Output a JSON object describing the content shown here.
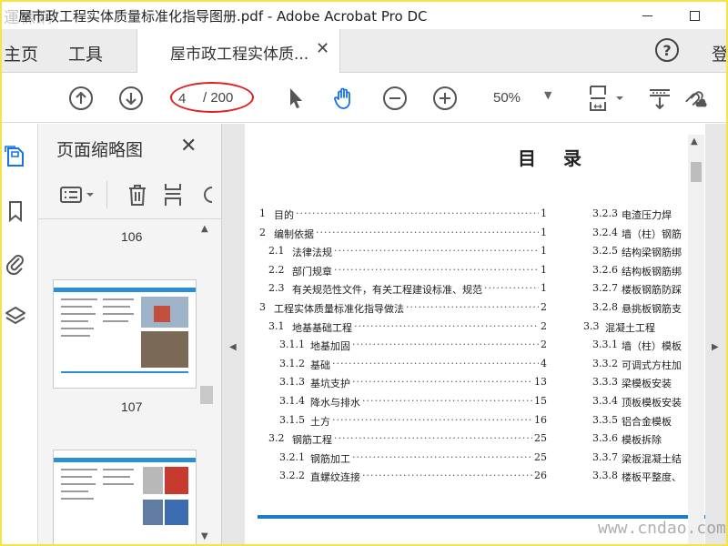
{
  "window": {
    "title": "屋市政工程实体质量标准化指导图册.pdf - Adobe Acrobat Pro DC",
    "watermark_top_left": "運棟網"
  },
  "tabs": {
    "home": "主页",
    "tools": "工具",
    "document": "屋市政工程实体质...",
    "close_glyph": "✕",
    "help_glyph": "?",
    "login": "登"
  },
  "toolbar": {
    "current_page": "4",
    "page_total": "/ 200",
    "zoom": "50%",
    "zoom_caret": "▼"
  },
  "thumbnails": {
    "title": "页面缩略图",
    "close_glyph": "✕",
    "labels": [
      "106",
      "107"
    ]
  },
  "toc": {
    "title": "目录",
    "left": [
      {
        "num": "1",
        "text": "目的",
        "page": "1"
      },
      {
        "num": "2",
        "text": "编制依据",
        "page": "1"
      },
      {
        "num": "2.1",
        "text": "法律法规",
        "page": "1"
      },
      {
        "num": "2.2",
        "text": "部门规章",
        "page": "1"
      },
      {
        "num": "2.3",
        "text": "有关规范性文件，有关工程建设标准、规范",
        "page": "1"
      },
      {
        "num": "3",
        "text": "工程实体质量标准化指导做法",
        "page": "2"
      },
      {
        "num": "3.1",
        "text": "地基基础工程",
        "page": "2"
      },
      {
        "num": "3.1.1",
        "text": "地基加固",
        "page": "2"
      },
      {
        "num": "3.1.2",
        "text": "基础",
        "page": "4"
      },
      {
        "num": "3.1.3",
        "text": "基坑支护",
        "page": "13"
      },
      {
        "num": "3.1.4",
        "text": "降水与排水",
        "page": "15"
      },
      {
        "num": "3.1.5",
        "text": "土方",
        "page": "16"
      },
      {
        "num": "3.2",
        "text": "钢筋工程",
        "page": "25"
      },
      {
        "num": "3.2.1",
        "text": "钢筋加工",
        "page": "25"
      },
      {
        "num": "3.2.2",
        "text": "直螺纹连接",
        "page": "26"
      }
    ],
    "right": [
      {
        "num": "3.2.3",
        "text": "电渣压力焊"
      },
      {
        "num": "3.2.4",
        "text": "墙（柱）钢筋"
      },
      {
        "num": "3.2.5",
        "text": "结构梁钢筋绑"
      },
      {
        "num": "3.2.6",
        "text": "结构板钢筋绑"
      },
      {
        "num": "3.2.7",
        "text": "楼板钢筋防踩"
      },
      {
        "num": "3.2.8",
        "text": "悬挑板钢筋支"
      },
      {
        "num": "3.3",
        "text": "混凝土工程"
      },
      {
        "num": "3.3.1",
        "text": "墙（柱）模板"
      },
      {
        "num": "3.3.2",
        "text": "可调式方柱加"
      },
      {
        "num": "3.3.3",
        "text": "梁模板安装"
      },
      {
        "num": "3.3.4",
        "text": "顶板模板安装"
      },
      {
        "num": "3.3.5",
        "text": "铝合金模板"
      },
      {
        "num": "3.3.6",
        "text": "模板拆除"
      },
      {
        "num": "3.3.7",
        "text": "梁板混凝土结"
      },
      {
        "num": "3.3.8",
        "text": "楼板平整度、"
      }
    ]
  },
  "watermark_bottom_right": "www.cndao.com",
  "colors": {
    "border_yellow": "#f2e44a",
    "annotation_red": "#e02020",
    "hand_tool_blue": "#1473e6",
    "doc_rule_blue": "#1c7cc6"
  }
}
